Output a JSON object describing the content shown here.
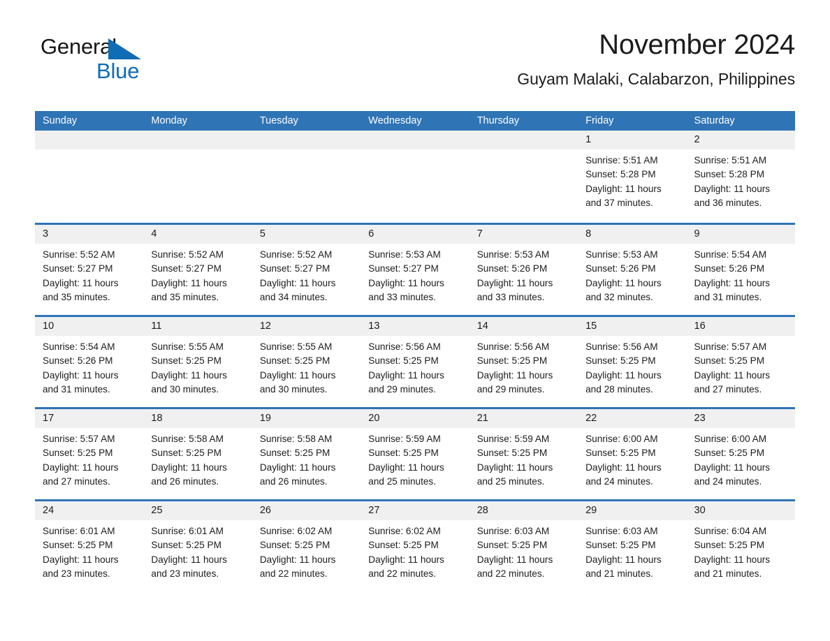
{
  "logo": {
    "word1": "General",
    "word2": "Blue",
    "triangle_color": "#0f6cb5",
    "triangle_icon": "triangle-icon"
  },
  "header": {
    "title": "November 2024",
    "subtitle": "Guyam Malaki, Calabarzon, Philippines"
  },
  "theme": {
    "header_blue": "#2f74b5",
    "date_band_gray": "#f0f0f0",
    "text_color": "#1c1c1c"
  },
  "weekdays": [
    "Sunday",
    "Monday",
    "Tuesday",
    "Wednesday",
    "Thursday",
    "Friday",
    "Saturday"
  ],
  "weeks": [
    [
      {
        "day": "",
        "sunrise": "",
        "sunset": "",
        "daylight": ""
      },
      {
        "day": "",
        "sunrise": "",
        "sunset": "",
        "daylight": ""
      },
      {
        "day": "",
        "sunrise": "",
        "sunset": "",
        "daylight": ""
      },
      {
        "day": "",
        "sunrise": "",
        "sunset": "",
        "daylight": ""
      },
      {
        "day": "",
        "sunrise": "",
        "sunset": "",
        "daylight": ""
      },
      {
        "day": "1",
        "sunrise": "Sunrise: 5:51 AM",
        "sunset": "Sunset: 5:28 PM",
        "daylight": "Daylight: 11 hours and 37 minutes."
      },
      {
        "day": "2",
        "sunrise": "Sunrise: 5:51 AM",
        "sunset": "Sunset: 5:28 PM",
        "daylight": "Daylight: 11 hours and 36 minutes."
      }
    ],
    [
      {
        "day": "3",
        "sunrise": "Sunrise: 5:52 AM",
        "sunset": "Sunset: 5:27 PM",
        "daylight": "Daylight: 11 hours and 35 minutes."
      },
      {
        "day": "4",
        "sunrise": "Sunrise: 5:52 AM",
        "sunset": "Sunset: 5:27 PM",
        "daylight": "Daylight: 11 hours and 35 minutes."
      },
      {
        "day": "5",
        "sunrise": "Sunrise: 5:52 AM",
        "sunset": "Sunset: 5:27 PM",
        "daylight": "Daylight: 11 hours and 34 minutes."
      },
      {
        "day": "6",
        "sunrise": "Sunrise: 5:53 AM",
        "sunset": "Sunset: 5:27 PM",
        "daylight": "Daylight: 11 hours and 33 minutes."
      },
      {
        "day": "7",
        "sunrise": "Sunrise: 5:53 AM",
        "sunset": "Sunset: 5:26 PM",
        "daylight": "Daylight: 11 hours and 33 minutes."
      },
      {
        "day": "8",
        "sunrise": "Sunrise: 5:53 AM",
        "sunset": "Sunset: 5:26 PM",
        "daylight": "Daylight: 11 hours and 32 minutes."
      },
      {
        "day": "9",
        "sunrise": "Sunrise: 5:54 AM",
        "sunset": "Sunset: 5:26 PM",
        "daylight": "Daylight: 11 hours and 31 minutes."
      }
    ],
    [
      {
        "day": "10",
        "sunrise": "Sunrise: 5:54 AM",
        "sunset": "Sunset: 5:26 PM",
        "daylight": "Daylight: 11 hours and 31 minutes."
      },
      {
        "day": "11",
        "sunrise": "Sunrise: 5:55 AM",
        "sunset": "Sunset: 5:25 PM",
        "daylight": "Daylight: 11 hours and 30 minutes."
      },
      {
        "day": "12",
        "sunrise": "Sunrise: 5:55 AM",
        "sunset": "Sunset: 5:25 PM",
        "daylight": "Daylight: 11 hours and 30 minutes."
      },
      {
        "day": "13",
        "sunrise": "Sunrise: 5:56 AM",
        "sunset": "Sunset: 5:25 PM",
        "daylight": "Daylight: 11 hours and 29 minutes."
      },
      {
        "day": "14",
        "sunrise": "Sunrise: 5:56 AM",
        "sunset": "Sunset: 5:25 PM",
        "daylight": "Daylight: 11 hours and 29 minutes."
      },
      {
        "day": "15",
        "sunrise": "Sunrise: 5:56 AM",
        "sunset": "Sunset: 5:25 PM",
        "daylight": "Daylight: 11 hours and 28 minutes."
      },
      {
        "day": "16",
        "sunrise": "Sunrise: 5:57 AM",
        "sunset": "Sunset: 5:25 PM",
        "daylight": "Daylight: 11 hours and 27 minutes."
      }
    ],
    [
      {
        "day": "17",
        "sunrise": "Sunrise: 5:57 AM",
        "sunset": "Sunset: 5:25 PM",
        "daylight": "Daylight: 11 hours and 27 minutes."
      },
      {
        "day": "18",
        "sunrise": "Sunrise: 5:58 AM",
        "sunset": "Sunset: 5:25 PM",
        "daylight": "Daylight: 11 hours and 26 minutes."
      },
      {
        "day": "19",
        "sunrise": "Sunrise: 5:58 AM",
        "sunset": "Sunset: 5:25 PM",
        "daylight": "Daylight: 11 hours and 26 minutes."
      },
      {
        "day": "20",
        "sunrise": "Sunrise: 5:59 AM",
        "sunset": "Sunset: 5:25 PM",
        "daylight": "Daylight: 11 hours and 25 minutes."
      },
      {
        "day": "21",
        "sunrise": "Sunrise: 5:59 AM",
        "sunset": "Sunset: 5:25 PM",
        "daylight": "Daylight: 11 hours and 25 minutes."
      },
      {
        "day": "22",
        "sunrise": "Sunrise: 6:00 AM",
        "sunset": "Sunset: 5:25 PM",
        "daylight": "Daylight: 11 hours and 24 minutes."
      },
      {
        "day": "23",
        "sunrise": "Sunrise: 6:00 AM",
        "sunset": "Sunset: 5:25 PM",
        "daylight": "Daylight: 11 hours and 24 minutes."
      }
    ],
    [
      {
        "day": "24",
        "sunrise": "Sunrise: 6:01 AM",
        "sunset": "Sunset: 5:25 PM",
        "daylight": "Daylight: 11 hours and 23 minutes."
      },
      {
        "day": "25",
        "sunrise": "Sunrise: 6:01 AM",
        "sunset": "Sunset: 5:25 PM",
        "daylight": "Daylight: 11 hours and 23 minutes."
      },
      {
        "day": "26",
        "sunrise": "Sunrise: 6:02 AM",
        "sunset": "Sunset: 5:25 PM",
        "daylight": "Daylight: 11 hours and 22 minutes."
      },
      {
        "day": "27",
        "sunrise": "Sunrise: 6:02 AM",
        "sunset": "Sunset: 5:25 PM",
        "daylight": "Daylight: 11 hours and 22 minutes."
      },
      {
        "day": "28",
        "sunrise": "Sunrise: 6:03 AM",
        "sunset": "Sunset: 5:25 PM",
        "daylight": "Daylight: 11 hours and 22 minutes."
      },
      {
        "day": "29",
        "sunrise": "Sunrise: 6:03 AM",
        "sunset": "Sunset: 5:25 PM",
        "daylight": "Daylight: 11 hours and 21 minutes."
      },
      {
        "day": "30",
        "sunrise": "Sunrise: 6:04 AM",
        "sunset": "Sunset: 5:25 PM",
        "daylight": "Daylight: 11 hours and 21 minutes."
      }
    ]
  ]
}
